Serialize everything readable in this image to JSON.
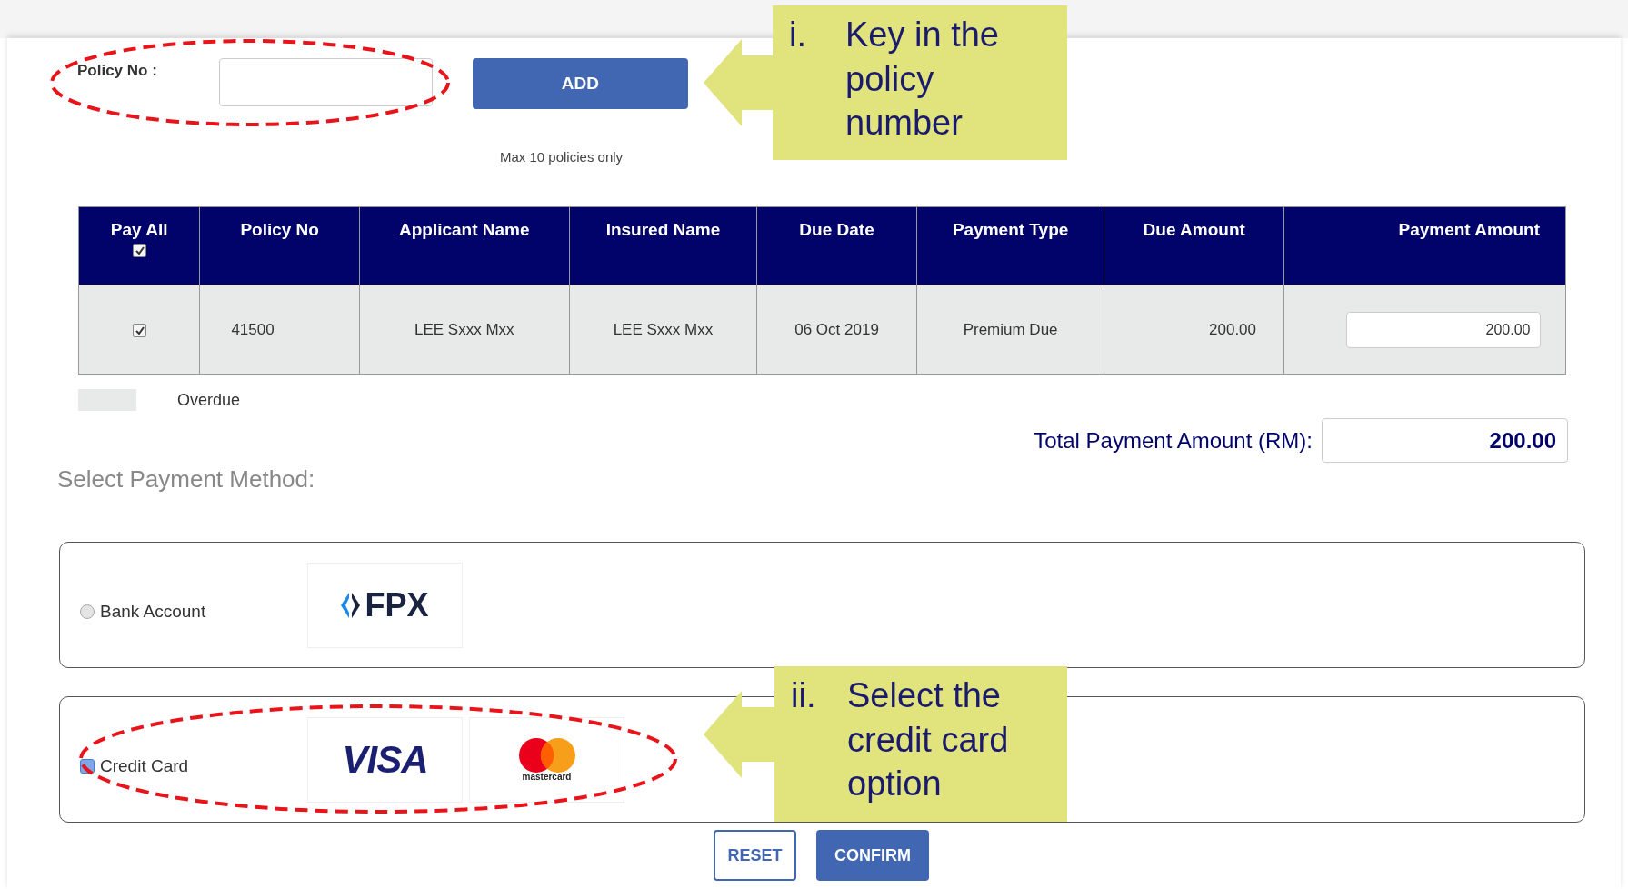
{
  "policy_entry": {
    "label": "Policy No :",
    "button": "ADD",
    "note": "Max 10 policies only"
  },
  "table": {
    "columns": [
      "Pay All",
      "Policy No",
      "Applicant Name",
      "Insured Name",
      "Due Date",
      "Payment Type",
      "Due Amount",
      "Payment Amount"
    ],
    "pay_all_checked": true,
    "rows": [
      {
        "checked": true,
        "policy_no": "41500",
        "applicant_name": "LEE Sxxx Mxx",
        "insured_name": "LEE Sxxx Mxx",
        "due_date": "06 Oct 2019",
        "payment_type": "Premium Due",
        "due_amount": "200.00",
        "payment_amount": "200.00"
      }
    ]
  },
  "legend": {
    "label": "Overdue"
  },
  "total": {
    "label": "Total Payment Amount (RM):",
    "value": "200.00"
  },
  "payment_methods": {
    "title": "Select Payment Method:",
    "options": [
      {
        "label": "Bank Account",
        "selected": false,
        "logos": [
          {
            "kind": "fpx",
            "text": "FPX"
          }
        ]
      },
      {
        "label": "Credit Card",
        "selected": true,
        "logos": [
          {
            "kind": "visa",
            "text": "VISA"
          },
          {
            "kind": "mastercard",
            "text": "mastercard"
          }
        ]
      }
    ]
  },
  "buttons": [
    {
      "label": "RESET",
      "kind": "outline"
    },
    {
      "label": "CONFIRM",
      "kind": "primary"
    }
  ],
  "annotations": [
    {
      "number": "i.",
      "text": "Key in the policy number"
    },
    {
      "number": "ii.",
      "text": "Select the credit card option"
    }
  ]
}
